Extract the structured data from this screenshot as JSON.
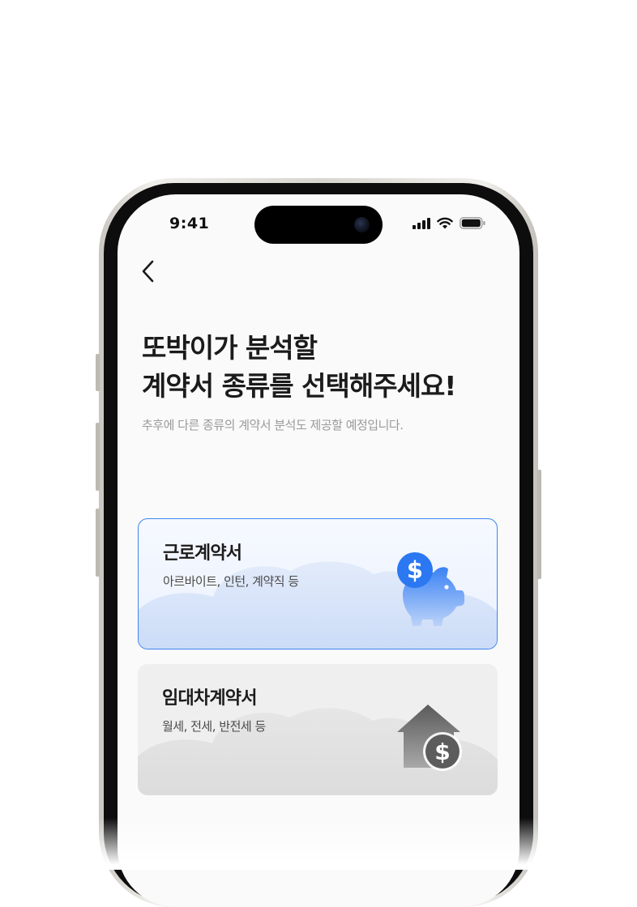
{
  "status_bar": {
    "time": "9:41"
  },
  "header": {
    "title_line1": "또박이가 분석할",
    "title_line2": "계약서 종류를 선택해주세요!",
    "subtitle": "추후에 다른 종류의 계약서 분석도 제공할 예정입니다."
  },
  "cards": [
    {
      "title": "근로계약서",
      "description": "아르바이트, 인턴, 계약직 등",
      "selected": true,
      "icon": "piggy-bank-dollar-icon"
    },
    {
      "title": "임대차계약서",
      "description": "월세, 전세, 반전세 등",
      "selected": false,
      "icon": "house-dollar-icon"
    }
  ],
  "colors": {
    "accent": "#3d84f0",
    "selected_bg": "#eaf1fd",
    "unselected_bg": "#efefef",
    "subtitle": "#9a9a9a"
  }
}
